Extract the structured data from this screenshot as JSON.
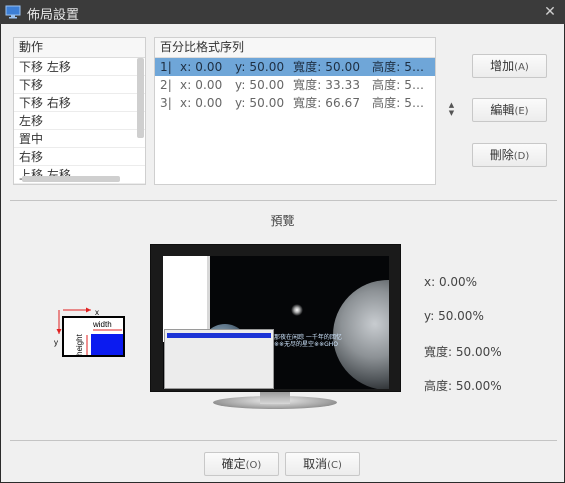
{
  "window": {
    "title": "佈局設置",
    "close_glyph": "✕"
  },
  "actions_list": {
    "header": "動作",
    "items": [
      "下移 左移",
      "下移",
      "下移 右移",
      "左移",
      "置中",
      "右移",
      "上移 左移"
    ]
  },
  "sequence_list": {
    "header": "百分比格式序列",
    "rows": [
      {
        "index": "1|",
        "x": "x:  0.00",
        "y": "y: 50.00",
        "w": "寬度:  50.00",
        "h": "高度:  5…"
      },
      {
        "index": "2|",
        "x": "x:  0.00",
        "y": "y: 50.00",
        "w": "寬度:  33.33",
        "h": "高度:  5…"
      },
      {
        "index": "3|",
        "x": "x:  0.00",
        "y": "y: 50.00",
        "w": "寬度:  66.67",
        "h": "高度:  5…"
      }
    ],
    "selected_index": 0
  },
  "buttons": {
    "add": {
      "label": "增加",
      "accel": "(A)"
    },
    "edit": {
      "label": "編輯",
      "accel": "(E)"
    },
    "delete": {
      "label": "刪除",
      "accel": "(D)"
    },
    "ok": {
      "label": "確定",
      "accel": "(O)"
    },
    "cancel": {
      "label": "取消",
      "accel": "(C)"
    }
  },
  "preview": {
    "label": "預覽",
    "diagram": {
      "x": "x",
      "y": "y",
      "width": "width",
      "height": "height"
    },
    "screen_caption": "那夜在闲踪 一千年的回忆 ※※无尽的星空※※GHO",
    "info": {
      "x": "x: 0.00%",
      "y": "y: 50.00%",
      "width": "寬度: 50.00%",
      "height": "高度: 50.00%"
    }
  },
  "colors": {
    "selection": "#6fa6d8",
    "titlebar": "#3b3b3b",
    "diagram_fill": "#0b1bf0",
    "diagram_arrow": "#e02020"
  }
}
